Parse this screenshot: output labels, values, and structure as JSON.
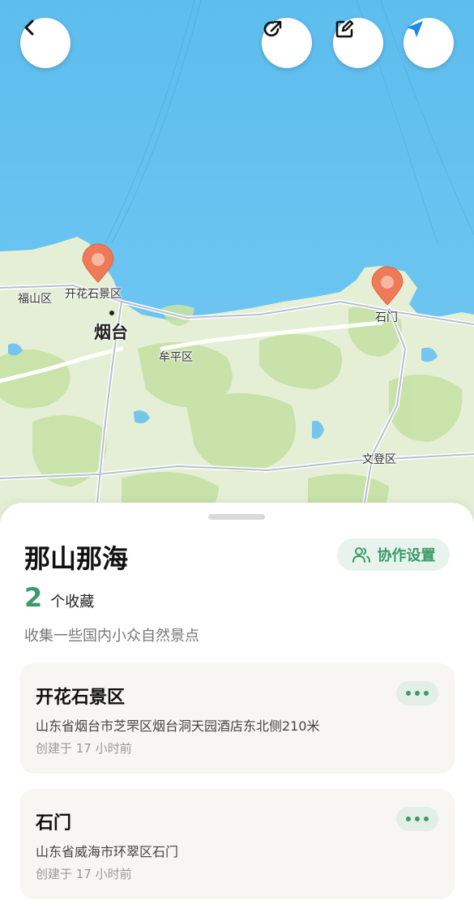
{
  "map": {
    "labels": {
      "kaihua": "开花石景区",
      "fushan": "福山区",
      "yantai": "烟台",
      "muping": "牟平区",
      "shimen": "石门",
      "wendeng": "文登区"
    },
    "buttons": {
      "back": "back-icon",
      "share": "share-icon",
      "edit": "edit-icon",
      "locate": "location-arrow-icon"
    },
    "colors": {
      "sea": "#64c3ef",
      "land": "#e3efd3",
      "pin": "#ee7a58"
    }
  },
  "collection": {
    "title": "那山那海",
    "collab_label": "协作设置",
    "count": "2",
    "count_label": "个收藏",
    "description": "收集一些国内小众自然景点"
  },
  "places": [
    {
      "name": "开花石景区",
      "address": "山东省烟台市芝罘区烟台洞天园酒店东北侧210米",
      "created": "创建于 17 小时前"
    },
    {
      "name": "石门",
      "address": "山东省威海市环翠区石门",
      "created": "创建于 17 小时前"
    }
  ],
  "accent_color": "#3a9a6a"
}
